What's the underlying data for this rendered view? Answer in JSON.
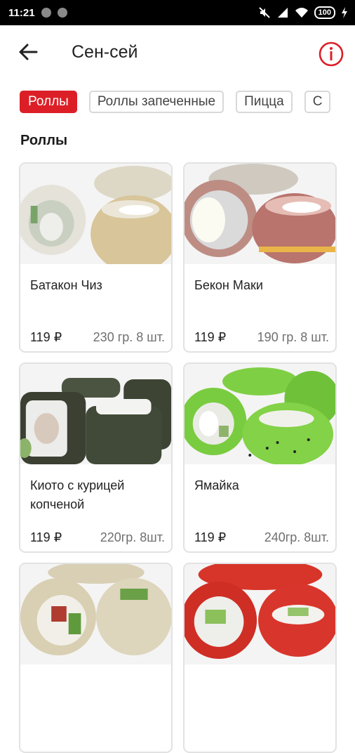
{
  "status_bar": {
    "time": "11:21",
    "battery": "100"
  },
  "header": {
    "title": "Сен-сей"
  },
  "tabs": [
    {
      "label": "Роллы",
      "active": true
    },
    {
      "label": "Роллы запеченные",
      "active": false
    },
    {
      "label": "Пицца",
      "active": false
    },
    {
      "label": "С",
      "active": false
    }
  ],
  "section": {
    "title": "Роллы"
  },
  "products": [
    {
      "name": "Батакон Чиз",
      "price": "119 ₽",
      "weight": "230 гр. 8 шт."
    },
    {
      "name": "Бекон Маки",
      "price": "119 ₽",
      "weight": "190 гр. 8 шт."
    },
    {
      "name": "Киото с курицей копченой",
      "price": "119 ₽",
      "weight": "220гр. 8шт."
    },
    {
      "name": "Ямайка",
      "price": "119 ₽",
      "weight": "240гр. 8шт."
    },
    {
      "name": "",
      "price": "",
      "weight": ""
    },
    {
      "name": "",
      "price": "",
      "weight": ""
    }
  ],
  "colors": {
    "accent": "#dc1f27",
    "status_bar": "#000000",
    "card_border": "#e2e2e2"
  }
}
